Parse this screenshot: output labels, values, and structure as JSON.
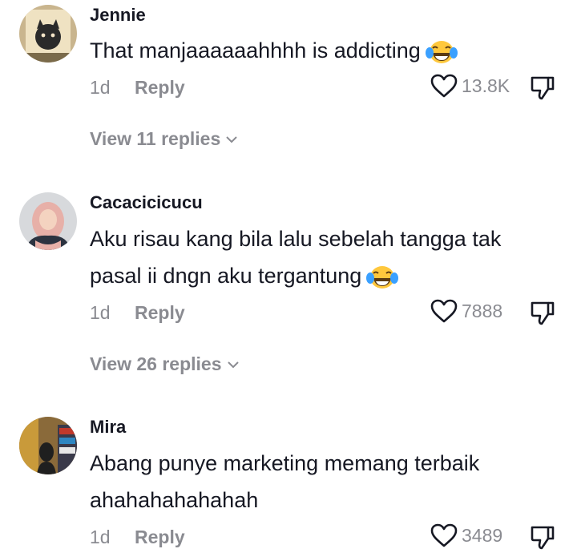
{
  "comments": [
    {
      "username": "Jennie",
      "text": "That manjaaaaaahhhh is addicting",
      "emoji": "laughing-tears-emoji",
      "time": "1d",
      "reply_label": "Reply",
      "likes": "13.8K",
      "view_replies": "View 11 replies"
    },
    {
      "username": "Cacacicicucu",
      "text": "Aku risau kang bila lalu sebelah tangga tak pasal ii dngn aku tergantung",
      "emoji": "laughing-tears-emoji",
      "time": "1d",
      "reply_label": "Reply",
      "likes": "7888",
      "view_replies": "View 26 replies"
    },
    {
      "username": "Mira",
      "text": "Abang punye marketing memang terbaik ahahahahahahah",
      "time": "1d",
      "reply_label": "Reply",
      "likes": "3489"
    }
  ],
  "icons": {
    "like": "heart-outline-icon",
    "dislike": "thumbs-down-icon",
    "expand": "chevron-down-icon"
  },
  "colors": {
    "primary_text": "#161823",
    "secondary_text": "#8a8b91",
    "emoji_face": "#ffc83d",
    "emoji_tears": "#3aa0ff"
  }
}
